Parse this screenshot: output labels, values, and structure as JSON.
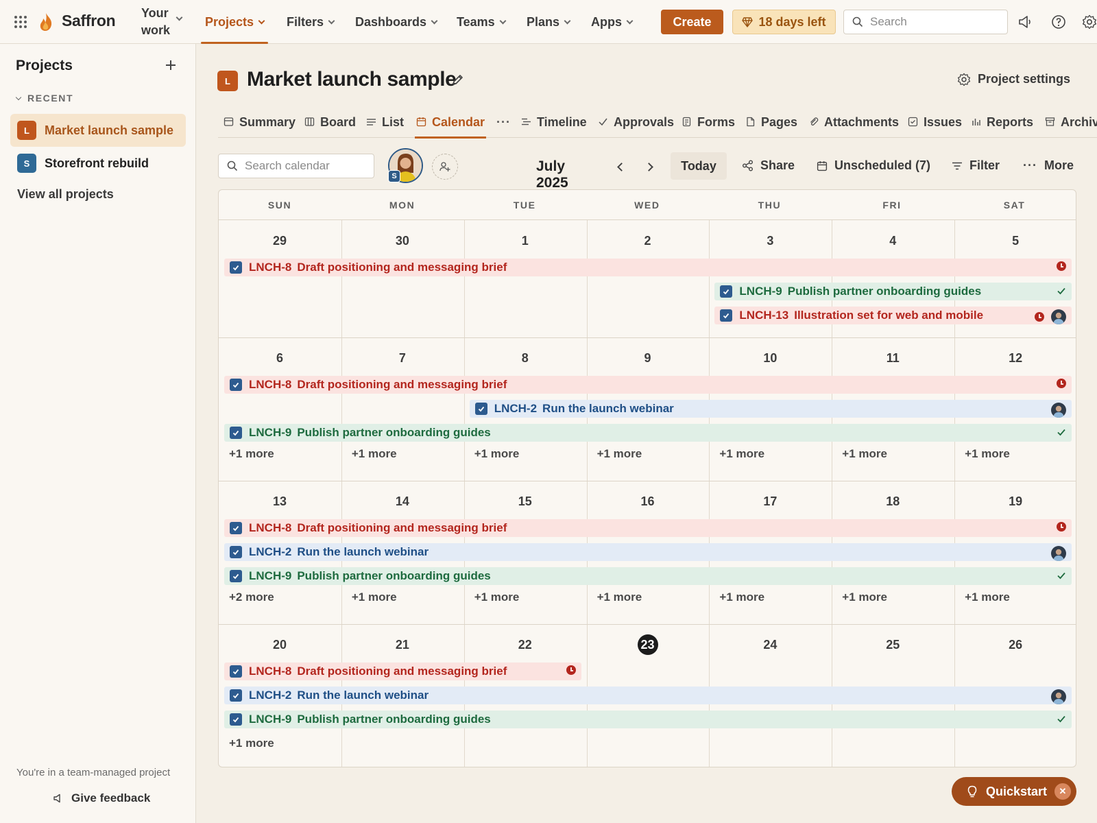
{
  "app": {
    "name": "Saffron",
    "brand_color": "#bb5b1d"
  },
  "topnav": {
    "your_work_line1": "Your",
    "your_work_line2": "work",
    "menus": [
      "Projects",
      "Filters",
      "Dashboards",
      "Teams",
      "Plans",
      "Apps"
    ],
    "active_menu": "Projects",
    "create_label": "Create",
    "trial_label": "18 days left",
    "search_placeholder": "Search"
  },
  "sidebar": {
    "title": "Projects",
    "recent_label": "RECENT",
    "items": [
      {
        "badge": "L",
        "label": "Market launch sample",
        "color": "#c0561d",
        "active": true
      },
      {
        "badge": "S",
        "label": "Storefront rebuild",
        "color": "#2f6a96",
        "active": false
      }
    ],
    "view_all": "View all projects",
    "footer_note": "You're in a team-managed project",
    "feedback": "Give feedback"
  },
  "project": {
    "badge": "L",
    "title": "Market launch sample",
    "settings_label": "Project settings"
  },
  "tabs": [
    {
      "label": "Summary",
      "icon": "summary-icon"
    },
    {
      "label": "Board",
      "icon": "board-icon"
    },
    {
      "label": "List",
      "icon": "list-icon"
    },
    {
      "label": "Calendar",
      "icon": "calendar-icon",
      "active": true
    },
    {
      "label": "",
      "icon": "more-dots-icon"
    },
    {
      "label": "Timeline",
      "icon": "timeline-icon"
    },
    {
      "label": "Approvals",
      "icon": "check-icon"
    },
    {
      "label": "Forms",
      "icon": "forms-icon"
    },
    {
      "label": "Pages",
      "icon": "page-icon"
    },
    {
      "label": "Attachments",
      "icon": "paperclip-icon"
    },
    {
      "label": "Issues",
      "icon": "issue-icon"
    },
    {
      "label": "Reports",
      "icon": "reports-icon"
    },
    {
      "label": "Archive",
      "icon": "archive-icon"
    }
  ],
  "toolbar": {
    "search_placeholder": "Search calendar",
    "avatar_badge": "S",
    "month": "July 2025",
    "today": "Today",
    "share": "Share",
    "unscheduled": "Unscheduled (7)",
    "filter": "Filter",
    "more": "More"
  },
  "calendar": {
    "weekdays": [
      "SUN",
      "MON",
      "TUE",
      "WED",
      "THU",
      "FRI",
      "SAT"
    ],
    "today": "23",
    "weeks": [
      {
        "days": [
          "29",
          "30",
          "1",
          "2",
          "3",
          "4",
          "5"
        ],
        "events": [
          {
            "key": "LNCH-8",
            "title": "Draft positioning and messaging brief",
            "color": "red",
            "start": 0,
            "end": 7,
            "row": 0,
            "end_icon": "overdue-clock-icon"
          },
          {
            "key": "LNCH-9",
            "title": "Publish partner onboarding guides",
            "color": "green",
            "start": 4,
            "end": 7,
            "row": 1,
            "end_icon": "done-check-icon"
          },
          {
            "key": "LNCH-13",
            "title": "Illustration set for web and mobile",
            "color": "red",
            "start": 4,
            "end": 7,
            "row": 2,
            "end_icon": "overdue-clock-icon",
            "assignee": true
          }
        ],
        "more": []
      },
      {
        "days": [
          "6",
          "7",
          "8",
          "9",
          "10",
          "11",
          "12"
        ],
        "events": [
          {
            "key": "LNCH-8",
            "title": "Draft positioning and messaging brief",
            "color": "red",
            "start": 0,
            "end": 7,
            "row": 0,
            "end_icon": "overdue-clock-icon"
          },
          {
            "key": "LNCH-2",
            "title": "Run the launch webinar",
            "color": "blue",
            "start": 2,
            "end": 7,
            "row": 1,
            "assignee": true
          },
          {
            "key": "LNCH-9",
            "title": "Publish partner onboarding guides",
            "color": "green",
            "start": 0,
            "end": 7,
            "row": 2,
            "end_icon": "done-check-icon"
          }
        ],
        "more": [
          "+1 more",
          "+1 more",
          "+1 more",
          "+1 more",
          "+1 more",
          "+1 more",
          "+1 more"
        ]
      },
      {
        "days": [
          "13",
          "14",
          "15",
          "16",
          "17",
          "18",
          "19"
        ],
        "events": [
          {
            "key": "LNCH-8",
            "title": "Draft positioning and messaging brief",
            "color": "red",
            "start": 0,
            "end": 7,
            "row": 0,
            "end_icon": "overdue-clock-icon"
          },
          {
            "key": "LNCH-2",
            "title": "Run the launch webinar",
            "color": "blue",
            "start": 0,
            "end": 7,
            "row": 1,
            "assignee": true
          },
          {
            "key": "LNCH-9",
            "title": "Publish partner onboarding guides",
            "color": "green",
            "start": 0,
            "end": 7,
            "row": 2,
            "end_icon": "done-check-icon"
          }
        ],
        "more": [
          "+2 more",
          "+1 more",
          "+1 more",
          "+1 more",
          "+1 more",
          "+1 more",
          "+1 more"
        ]
      },
      {
        "days": [
          "20",
          "21",
          "22",
          "23",
          "24",
          "25",
          "26"
        ],
        "events": [
          {
            "key": "LNCH-8",
            "title": "Draft positioning and messaging brief",
            "color": "red",
            "start": 0,
            "end": 3,
            "row": 0,
            "end_icon": "overdue-clock-icon"
          },
          {
            "key": "LNCH-2",
            "title": "Run the launch webinar",
            "color": "blue",
            "start": 0,
            "end": 7,
            "row": 1,
            "assignee": true
          },
          {
            "key": "LNCH-9",
            "title": "Publish partner onboarding guides",
            "color": "green",
            "start": 0,
            "end": 7,
            "row": 2,
            "end_icon": "done-check-icon"
          }
        ],
        "more": [
          "+1 more"
        ]
      }
    ]
  },
  "quickstart": {
    "label": "Quickstart"
  }
}
